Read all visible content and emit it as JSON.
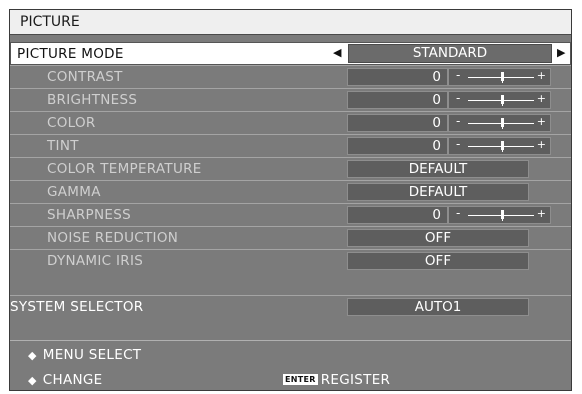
{
  "menu": {
    "title": "PICTURE",
    "picture_mode": {
      "label": "PICTURE MODE",
      "value": "STANDARD"
    },
    "items": [
      {
        "label": "CONTRAST",
        "value": "0",
        "type": "slider",
        "level": 0.5
      },
      {
        "label": "BRIGHTNESS",
        "value": "0",
        "type": "slider",
        "level": 0.5
      },
      {
        "label": "COLOR",
        "value": "0",
        "type": "slider",
        "level": 0.5
      },
      {
        "label": "TINT",
        "value": "0",
        "type": "slider",
        "level": 0.5
      },
      {
        "label": "COLOR TEMPERATURE",
        "value": "DEFAULT",
        "type": "text"
      },
      {
        "label": "GAMMA",
        "value": "DEFAULT",
        "type": "text"
      },
      {
        "label": "SHARPNESS",
        "value": "0",
        "type": "slider",
        "level": 0.5
      },
      {
        "label": "NOISE REDUCTION",
        "value": "OFF",
        "type": "text"
      },
      {
        "label": "DYNAMIC IRIS",
        "value": "OFF",
        "type": "text"
      }
    ],
    "system_selector": {
      "label": "SYSTEM SELECTOR",
      "value": "AUTO1"
    }
  },
  "footer": {
    "menu_select": "MENU SELECT",
    "change": "CHANGE",
    "enter_key": "ENTER",
    "register": "REGISTER"
  },
  "colors": {
    "panel": "#7b7b7b",
    "title_bg": "#efefef",
    "selected_row": "#ffffff",
    "value_box": "#5e5e5e"
  },
  "icons": {
    "menu_select": "up-down-arrows-icon",
    "change": "left-right-arrows-icon",
    "mode_left": "left-triangle-icon",
    "mode_right": "right-triangle-icon"
  }
}
